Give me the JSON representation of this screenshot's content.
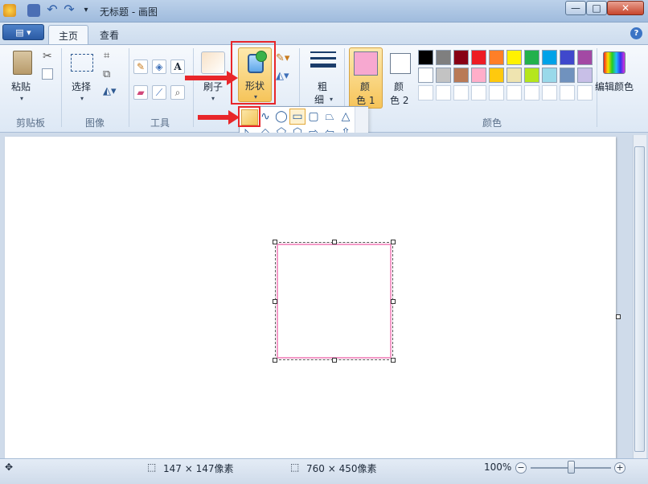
{
  "window": {
    "title": "无标题 - 画图"
  },
  "menu": {
    "file_icon": "menu-icon",
    "tabs": [
      {
        "label": "主页"
      },
      {
        "label": "查看"
      }
    ]
  },
  "clipboard": {
    "paste": "粘贴",
    "group": "剪贴板"
  },
  "image": {
    "select": "选择",
    "group": "图像"
  },
  "tools": {
    "group": "工具",
    "text_glyph": "A"
  },
  "brush": {
    "label": "刷子"
  },
  "shapes": {
    "label": "形状"
  },
  "size": {
    "label_top": "粗",
    "label_bottom": "细"
  },
  "color1": {
    "label_top": "颜",
    "label_bottom": "色 1",
    "value": "#f7a8d0"
  },
  "color2": {
    "label_top": "颜",
    "label_bottom": "色 2",
    "value": "#ffffff"
  },
  "edit_colors": {
    "label": "编辑颜色"
  },
  "colors": {
    "group": "颜色",
    "row1": [
      "#000000",
      "#7f7f7f",
      "#880015",
      "#ed1c24",
      "#ff7f27",
      "#fff200",
      "#22b14c",
      "#00a2e8",
      "#3f48cc",
      "#a349a4"
    ],
    "row2": [
      "#ffffff",
      "#c3c3c3",
      "#b97a57",
      "#ffaec9",
      "#ffc90e",
      "#efe4b0",
      "#b5e61d",
      "#99d9ea",
      "#7092be",
      "#c8bfe7"
    ]
  },
  "status": {
    "selection": "147 × 147像素",
    "canvas": "760 × 450像素",
    "zoom": "100%"
  }
}
